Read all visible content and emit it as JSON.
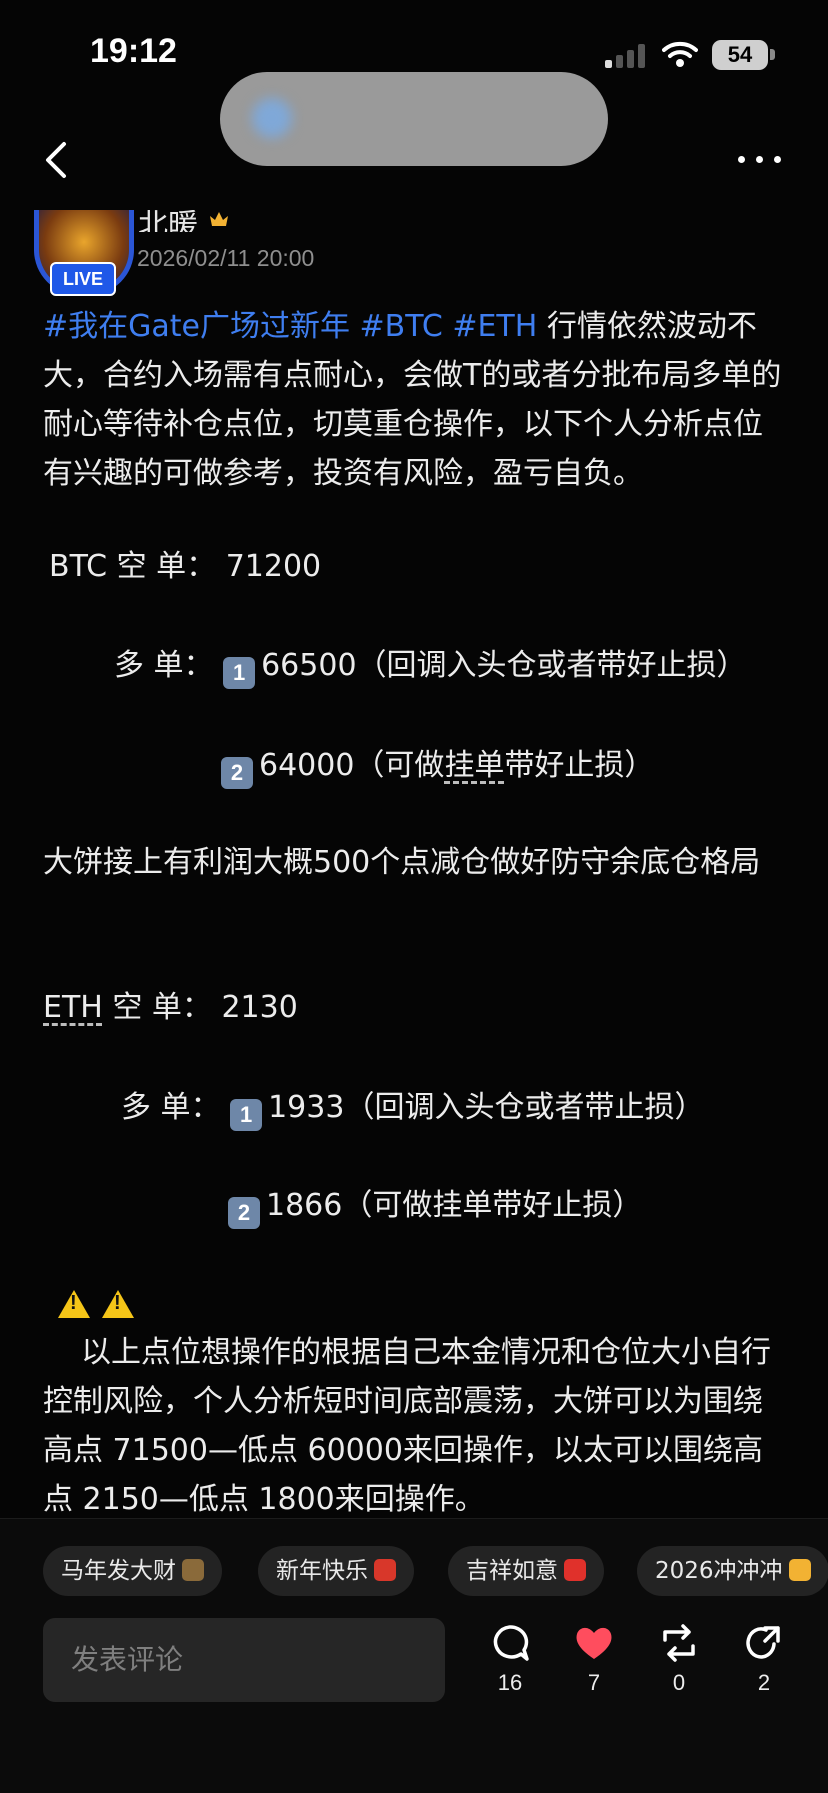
{
  "status": {
    "time": "19:12",
    "battery": "54"
  },
  "header": {
    "pill_line1": "",
    "pill_line2": ""
  },
  "author": {
    "name": "北暖",
    "date": "2026/02/11 20:00",
    "live_badge": "LIVE"
  },
  "post": {
    "tags": [
      "#我在Gate广场过新年",
      "#BTC",
      "#ETH"
    ],
    "intro": " 行情依然波动不大，合约入场需有点耐心，会做T的或者分批布局多单的耐心等待补仓点位，切莫重仓操作，以下个人分析点位有兴趣的可做参考，投资有风险，盈亏自负。",
    "btc_short": "BTC 空 单： 71200",
    "btc_long_label": "多 单：",
    "btc_long1_num": "1",
    "btc_long1": "66500（回调入头仓或者带好止损）",
    "btc_long2_num": "2",
    "btc_long2_a": "64000（可做",
    "btc_long2_b": "挂单",
    "btc_long2_c": "带好止损）",
    "btc_note": "大饼接上有利润大概500个点减仓做好防守余底仓格局",
    "eth_short_a": "ETH",
    "eth_short_b": " 空 单： 2130",
    "eth_long_label": "多 单：",
    "eth_long1_num": "1",
    "eth_long1": "1933（回调入头仓或者带止损）",
    "eth_long2_num": "2",
    "eth_long2": "1866（可做挂单带好止损）",
    "closing": "以上点位想操作的根据自己本金情况和仓位大小自行控制风险，个人分析短时间底部震荡，大饼可以为围绕高点 71500—低点 60000来回操作，以太可以围绕高点 2150—低点 1800来回操作。"
  },
  "quick_replies": [
    {
      "label": "马年发大财",
      "icon": "horse-emoji",
      "color": "#8a6a3a"
    },
    {
      "label": "新年快乐",
      "icon": "firecracker-emoji",
      "color": "#d8372a"
    },
    {
      "label": "吉祥如意",
      "icon": "red-envelope-emoji",
      "color": "#e0312b"
    },
    {
      "label": "2026冲冲冲",
      "icon": "fist-emoji",
      "color": "#f2b233"
    }
  ],
  "comment_placeholder": "发表评论",
  "actions": {
    "comments": "16",
    "likes": "7",
    "reposts": "0",
    "shares": "2"
  },
  "colors": {
    "hashtag": "#3f7ef0",
    "like": "#ff4d5e",
    "live": "#1f58e8"
  }
}
